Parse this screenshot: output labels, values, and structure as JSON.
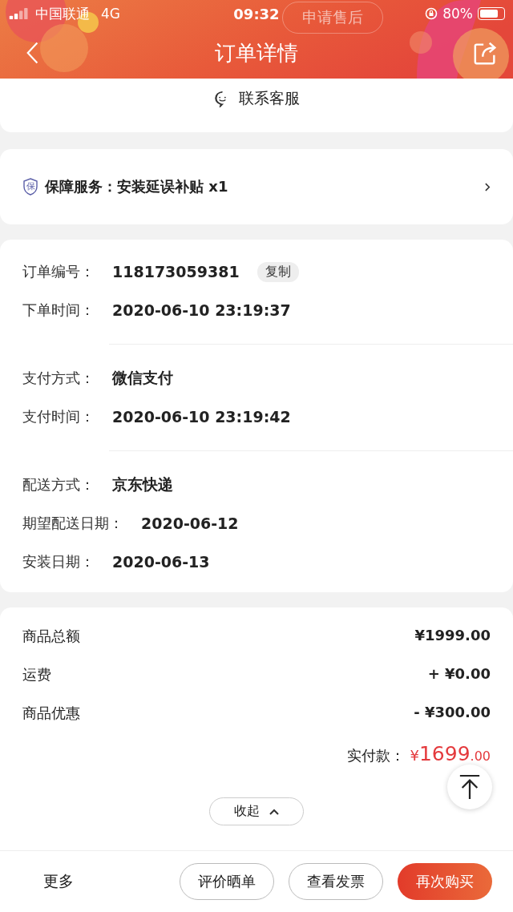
{
  "status_bar": {
    "carrier": "中国联通",
    "network": "4G",
    "time": "09:32",
    "battery": "80%"
  },
  "ghost_buttons": [
    "申请售后"
  ],
  "header": {
    "title": "订单详情"
  },
  "contact": {
    "label": "联系客服"
  },
  "guarantee": {
    "label": "保障服务：安装延误补贴 x1",
    "icon_text": "保"
  },
  "info_groups": [
    [
      {
        "label": "订单编号：",
        "value": "118173059381",
        "action": "复制"
      },
      {
        "label": "下单时间：",
        "value": "2020-06-10 23:19:37"
      }
    ],
    [
      {
        "label": "支付方式：",
        "value": "微信支付"
      },
      {
        "label": "支付时间：",
        "value": "2020-06-10 23:19:42"
      }
    ],
    [
      {
        "label": "配送方式：",
        "value": "京东快递"
      },
      {
        "label": "期望配送日期：",
        "value": "2020-06-12"
      },
      {
        "label": "安装日期：",
        "value": "2020-06-13"
      }
    ]
  ],
  "amounts": [
    {
      "label": "商品总额",
      "value": "¥1999.00"
    },
    {
      "label": "运费",
      "value": "+ ¥0.00"
    },
    {
      "label": "商品优惠",
      "value": "- ¥300.00"
    }
  ],
  "total": {
    "label": "实付款：",
    "currency": "¥",
    "integer": "1699",
    "decimal": ".00"
  },
  "collapse": {
    "label": "收起"
  },
  "bottom_bar": {
    "more": "更多",
    "buttons": [
      {
        "label": "评价晒单",
        "primary": false
      },
      {
        "label": "查看发票",
        "primary": false
      },
      {
        "label": "再次购买",
        "primary": true
      }
    ]
  }
}
